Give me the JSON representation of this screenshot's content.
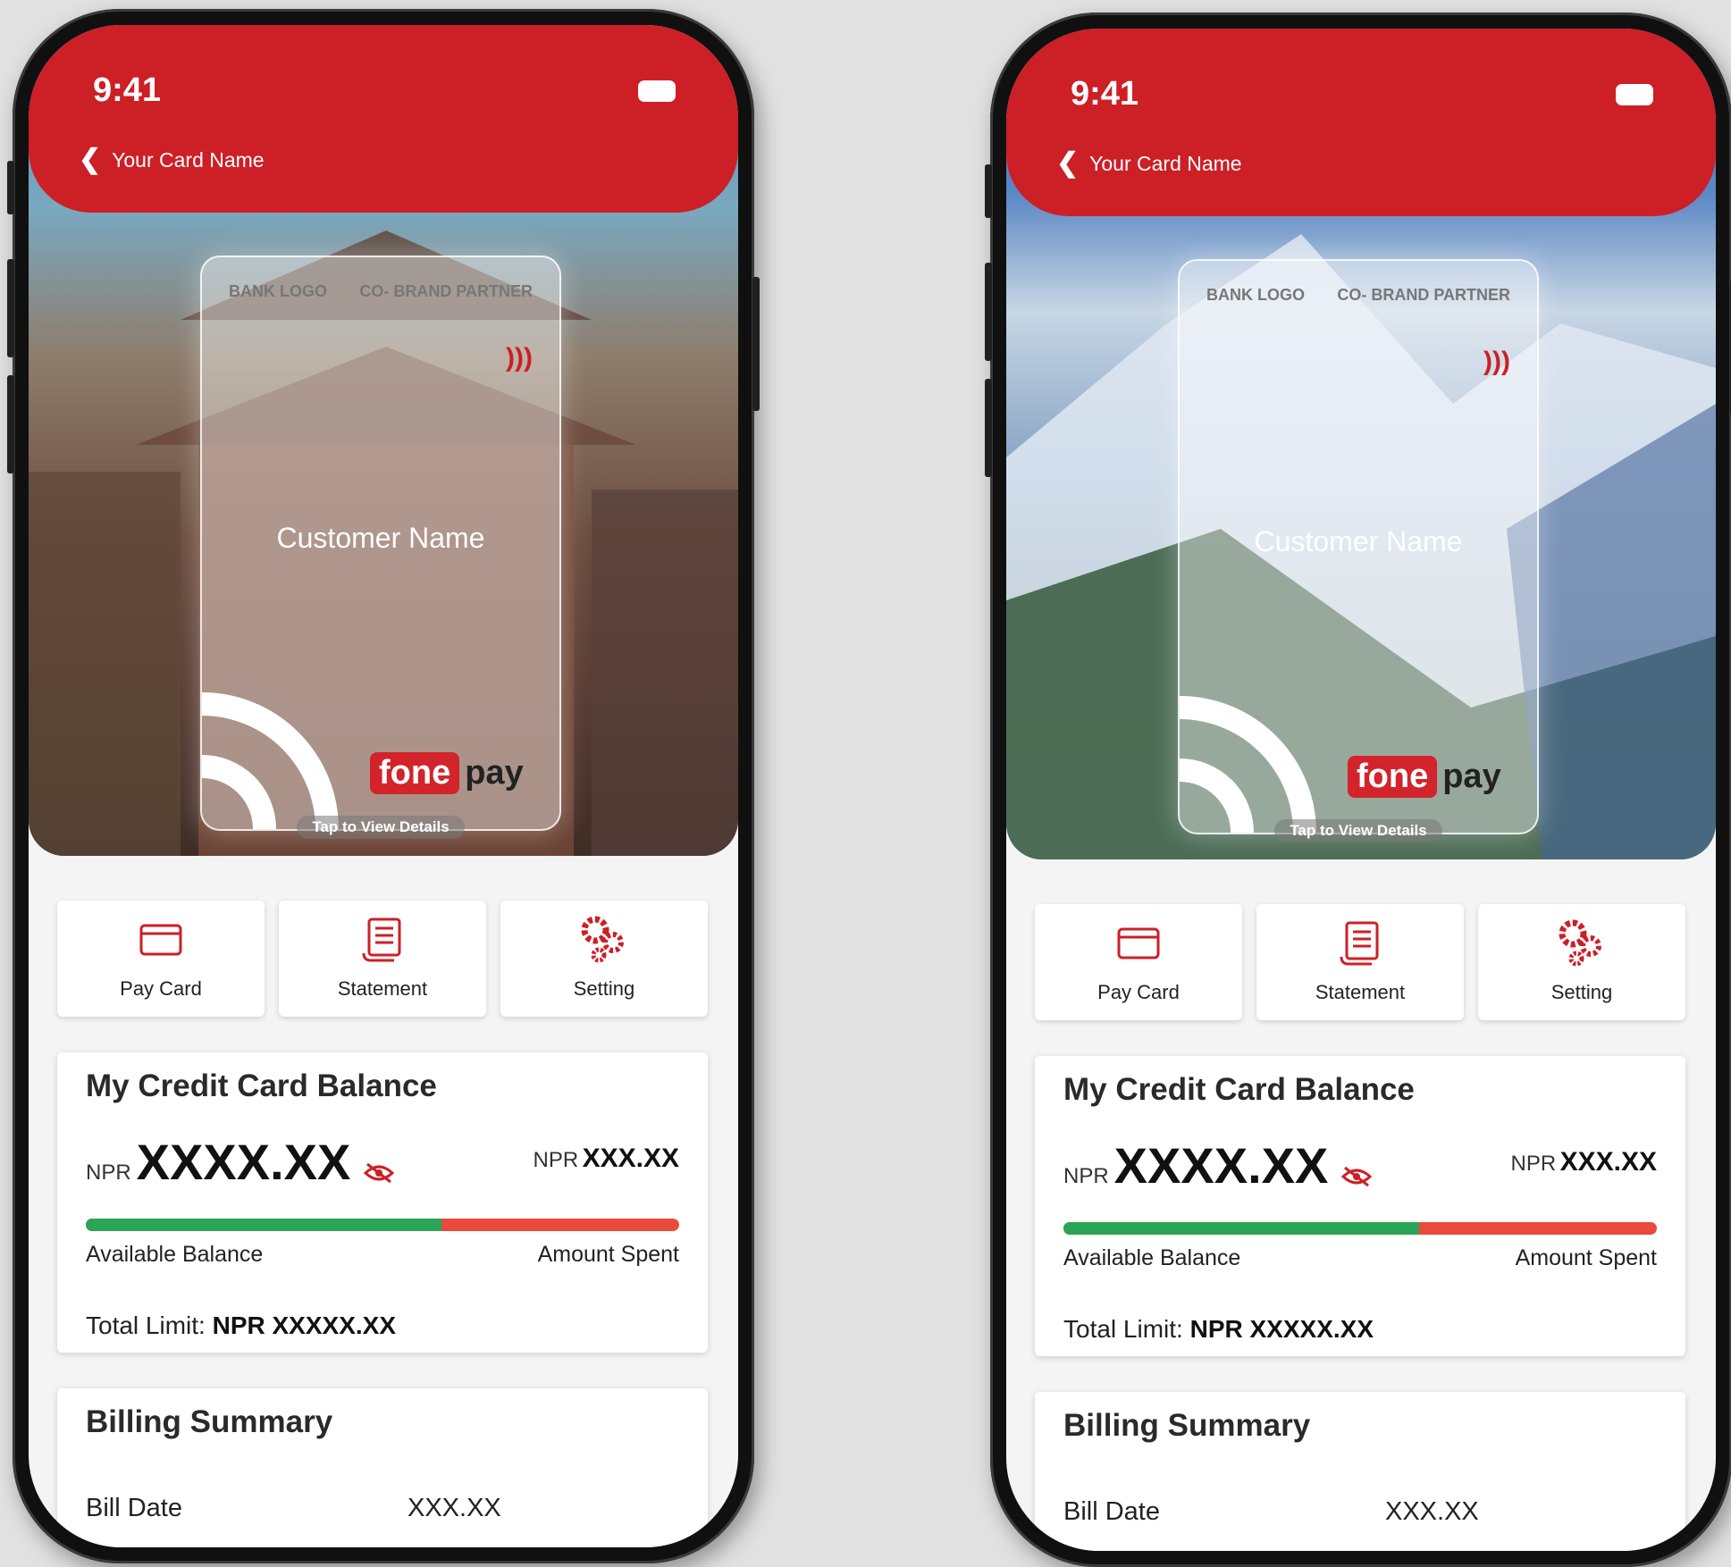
{
  "phones": [
    {
      "status_time": "9:41",
      "header_title": "Your Card Name",
      "background": "temple",
      "card": {
        "bank_logo": "BANK LOGO",
        "co_brand": "CO- BRAND PARTNER",
        "customer_name": "Customer Name",
        "brand_fone": "fone",
        "brand_pay": "pay",
        "tap_hint": "Tap to View Details"
      },
      "actions": [
        {
          "label": "Pay Card",
          "icon": "credit-card-icon"
        },
        {
          "label": "Statement",
          "icon": "statement-icon"
        },
        {
          "label": "Setting",
          "icon": "gears-icon"
        }
      ],
      "balance": {
        "title": "My Credit Card Balance",
        "currency": "NPR",
        "available_amount": "XXXX.XX",
        "spent_currency": "NPR",
        "spent_amount": "XXX.XX",
        "available_fraction": 0.6,
        "available_label": "Available Balance",
        "spent_label": "Amount Spent",
        "limit_label": "Total Limit:",
        "limit_value": "NPR XXXXX.XX"
      },
      "billing": {
        "title": "Billing Summary",
        "bill_date_label": "Bill Date",
        "bill_date_value": "XXX.XX"
      }
    },
    {
      "status_time": "9:41",
      "header_title": "Your Card Name",
      "background": "mountain",
      "card": {
        "bank_logo": "BANK LOGO",
        "co_brand": "CO- BRAND PARTNER",
        "customer_name": "Customer Name",
        "brand_fone": "fone",
        "brand_pay": "pay",
        "tap_hint": "Tap to View Details"
      },
      "actions": [
        {
          "label": "Pay Card",
          "icon": "credit-card-icon"
        },
        {
          "label": "Statement",
          "icon": "statement-icon"
        },
        {
          "label": "Setting",
          "icon": "gears-icon"
        }
      ],
      "balance": {
        "title": "My Credit Card Balance",
        "currency": "NPR",
        "available_amount": "XXXX.XX",
        "spent_currency": "NPR",
        "spent_amount": "XXX.XX",
        "available_fraction": 0.6,
        "available_label": "Available Balance",
        "spent_label": "Amount Spent",
        "limit_label": "Total Limit:",
        "limit_value": "NPR XXXXX.XX"
      },
      "billing": {
        "title": "Billing Summary",
        "bill_date_label": "Bill Date",
        "bill_date_value": "XXX.XX"
      }
    }
  ],
  "colors": {
    "brand_red": "#cd1f26",
    "available_green": "#2aa456",
    "spent_red": "#ea4a3c"
  }
}
